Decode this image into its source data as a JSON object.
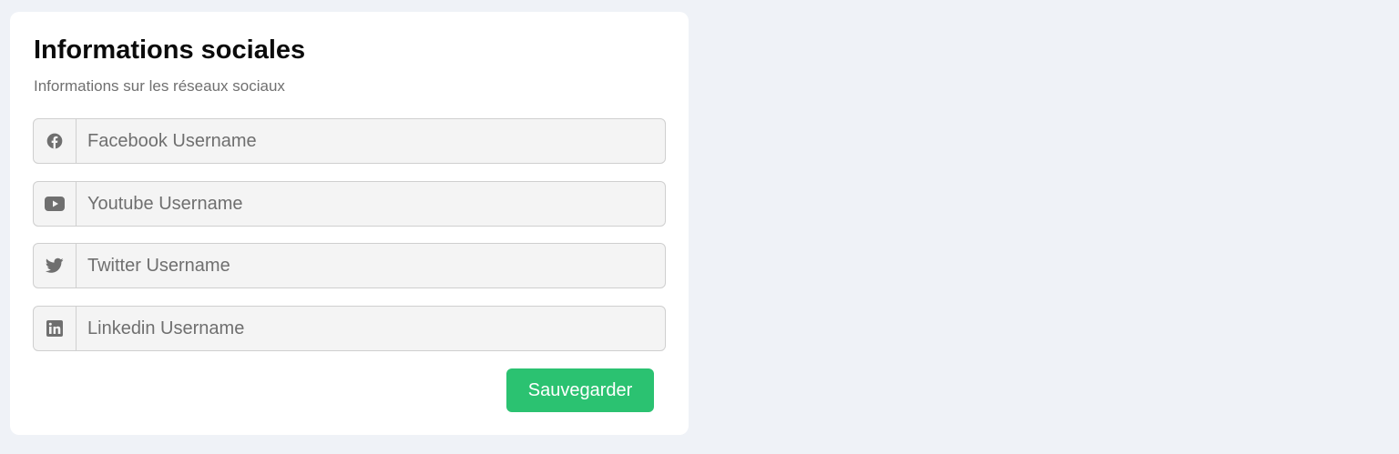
{
  "card": {
    "title": "Informations sociales",
    "subtitle": "Informations sur les réseaux sociaux"
  },
  "fields": {
    "facebook": {
      "placeholder": "Facebook Username",
      "value": "",
      "icon": "facebook-icon"
    },
    "youtube": {
      "placeholder": "Youtube Username",
      "value": "",
      "icon": "youtube-icon"
    },
    "twitter": {
      "placeholder": "Twitter Username",
      "value": "",
      "icon": "twitter-icon"
    },
    "linkedin": {
      "placeholder": "Linkedin Username",
      "value": "",
      "icon": "linkedin-icon"
    }
  },
  "actions": {
    "save_label": "Sauvegarder"
  },
  "colors": {
    "page_background": "#eff2f7",
    "card_background": "#ffffff",
    "input_background": "#f4f4f4",
    "icon": "#6f6f6f",
    "primary_button": "#2bc271"
  }
}
